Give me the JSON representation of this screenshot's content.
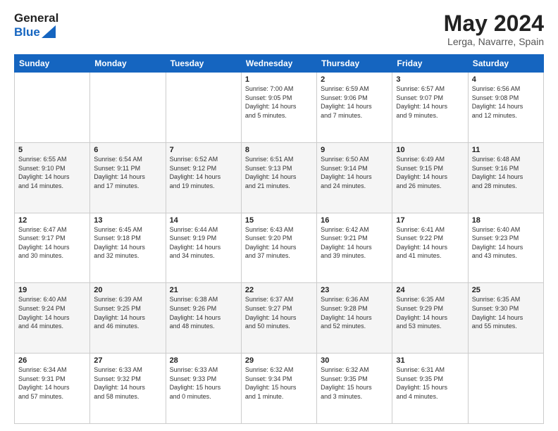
{
  "header": {
    "logo_general": "General",
    "logo_blue": "Blue",
    "title": "May 2024",
    "subtitle": "Lerga, Navarre, Spain"
  },
  "weekdays": [
    "Sunday",
    "Monday",
    "Tuesday",
    "Wednesday",
    "Thursday",
    "Friday",
    "Saturday"
  ],
  "weeks": [
    [
      {
        "day": "",
        "info": ""
      },
      {
        "day": "",
        "info": ""
      },
      {
        "day": "",
        "info": ""
      },
      {
        "day": "1",
        "info": "Sunrise: 7:00 AM\nSunset: 9:05 PM\nDaylight: 14 hours\nand 5 minutes."
      },
      {
        "day": "2",
        "info": "Sunrise: 6:59 AM\nSunset: 9:06 PM\nDaylight: 14 hours\nand 7 minutes."
      },
      {
        "day": "3",
        "info": "Sunrise: 6:57 AM\nSunset: 9:07 PM\nDaylight: 14 hours\nand 9 minutes."
      },
      {
        "day": "4",
        "info": "Sunrise: 6:56 AM\nSunset: 9:08 PM\nDaylight: 14 hours\nand 12 minutes."
      }
    ],
    [
      {
        "day": "5",
        "info": "Sunrise: 6:55 AM\nSunset: 9:10 PM\nDaylight: 14 hours\nand 14 minutes."
      },
      {
        "day": "6",
        "info": "Sunrise: 6:54 AM\nSunset: 9:11 PM\nDaylight: 14 hours\nand 17 minutes."
      },
      {
        "day": "7",
        "info": "Sunrise: 6:52 AM\nSunset: 9:12 PM\nDaylight: 14 hours\nand 19 minutes."
      },
      {
        "day": "8",
        "info": "Sunrise: 6:51 AM\nSunset: 9:13 PM\nDaylight: 14 hours\nand 21 minutes."
      },
      {
        "day": "9",
        "info": "Sunrise: 6:50 AM\nSunset: 9:14 PM\nDaylight: 14 hours\nand 24 minutes."
      },
      {
        "day": "10",
        "info": "Sunrise: 6:49 AM\nSunset: 9:15 PM\nDaylight: 14 hours\nand 26 minutes."
      },
      {
        "day": "11",
        "info": "Sunrise: 6:48 AM\nSunset: 9:16 PM\nDaylight: 14 hours\nand 28 minutes."
      }
    ],
    [
      {
        "day": "12",
        "info": "Sunrise: 6:47 AM\nSunset: 9:17 PM\nDaylight: 14 hours\nand 30 minutes."
      },
      {
        "day": "13",
        "info": "Sunrise: 6:45 AM\nSunset: 9:18 PM\nDaylight: 14 hours\nand 32 minutes."
      },
      {
        "day": "14",
        "info": "Sunrise: 6:44 AM\nSunset: 9:19 PM\nDaylight: 14 hours\nand 34 minutes."
      },
      {
        "day": "15",
        "info": "Sunrise: 6:43 AM\nSunset: 9:20 PM\nDaylight: 14 hours\nand 37 minutes."
      },
      {
        "day": "16",
        "info": "Sunrise: 6:42 AM\nSunset: 9:21 PM\nDaylight: 14 hours\nand 39 minutes."
      },
      {
        "day": "17",
        "info": "Sunrise: 6:41 AM\nSunset: 9:22 PM\nDaylight: 14 hours\nand 41 minutes."
      },
      {
        "day": "18",
        "info": "Sunrise: 6:40 AM\nSunset: 9:23 PM\nDaylight: 14 hours\nand 43 minutes."
      }
    ],
    [
      {
        "day": "19",
        "info": "Sunrise: 6:40 AM\nSunset: 9:24 PM\nDaylight: 14 hours\nand 44 minutes."
      },
      {
        "day": "20",
        "info": "Sunrise: 6:39 AM\nSunset: 9:25 PM\nDaylight: 14 hours\nand 46 minutes."
      },
      {
        "day": "21",
        "info": "Sunrise: 6:38 AM\nSunset: 9:26 PM\nDaylight: 14 hours\nand 48 minutes."
      },
      {
        "day": "22",
        "info": "Sunrise: 6:37 AM\nSunset: 9:27 PM\nDaylight: 14 hours\nand 50 minutes."
      },
      {
        "day": "23",
        "info": "Sunrise: 6:36 AM\nSunset: 9:28 PM\nDaylight: 14 hours\nand 52 minutes."
      },
      {
        "day": "24",
        "info": "Sunrise: 6:35 AM\nSunset: 9:29 PM\nDaylight: 14 hours\nand 53 minutes."
      },
      {
        "day": "25",
        "info": "Sunrise: 6:35 AM\nSunset: 9:30 PM\nDaylight: 14 hours\nand 55 minutes."
      }
    ],
    [
      {
        "day": "26",
        "info": "Sunrise: 6:34 AM\nSunset: 9:31 PM\nDaylight: 14 hours\nand 57 minutes."
      },
      {
        "day": "27",
        "info": "Sunrise: 6:33 AM\nSunset: 9:32 PM\nDaylight: 14 hours\nand 58 minutes."
      },
      {
        "day": "28",
        "info": "Sunrise: 6:33 AM\nSunset: 9:33 PM\nDaylight: 15 hours\nand 0 minutes."
      },
      {
        "day": "29",
        "info": "Sunrise: 6:32 AM\nSunset: 9:34 PM\nDaylight: 15 hours\nand 1 minute."
      },
      {
        "day": "30",
        "info": "Sunrise: 6:32 AM\nSunset: 9:35 PM\nDaylight: 15 hours\nand 3 minutes."
      },
      {
        "day": "31",
        "info": "Sunrise: 6:31 AM\nSunset: 9:35 PM\nDaylight: 15 hours\nand 4 minutes."
      },
      {
        "day": "",
        "info": ""
      }
    ]
  ]
}
